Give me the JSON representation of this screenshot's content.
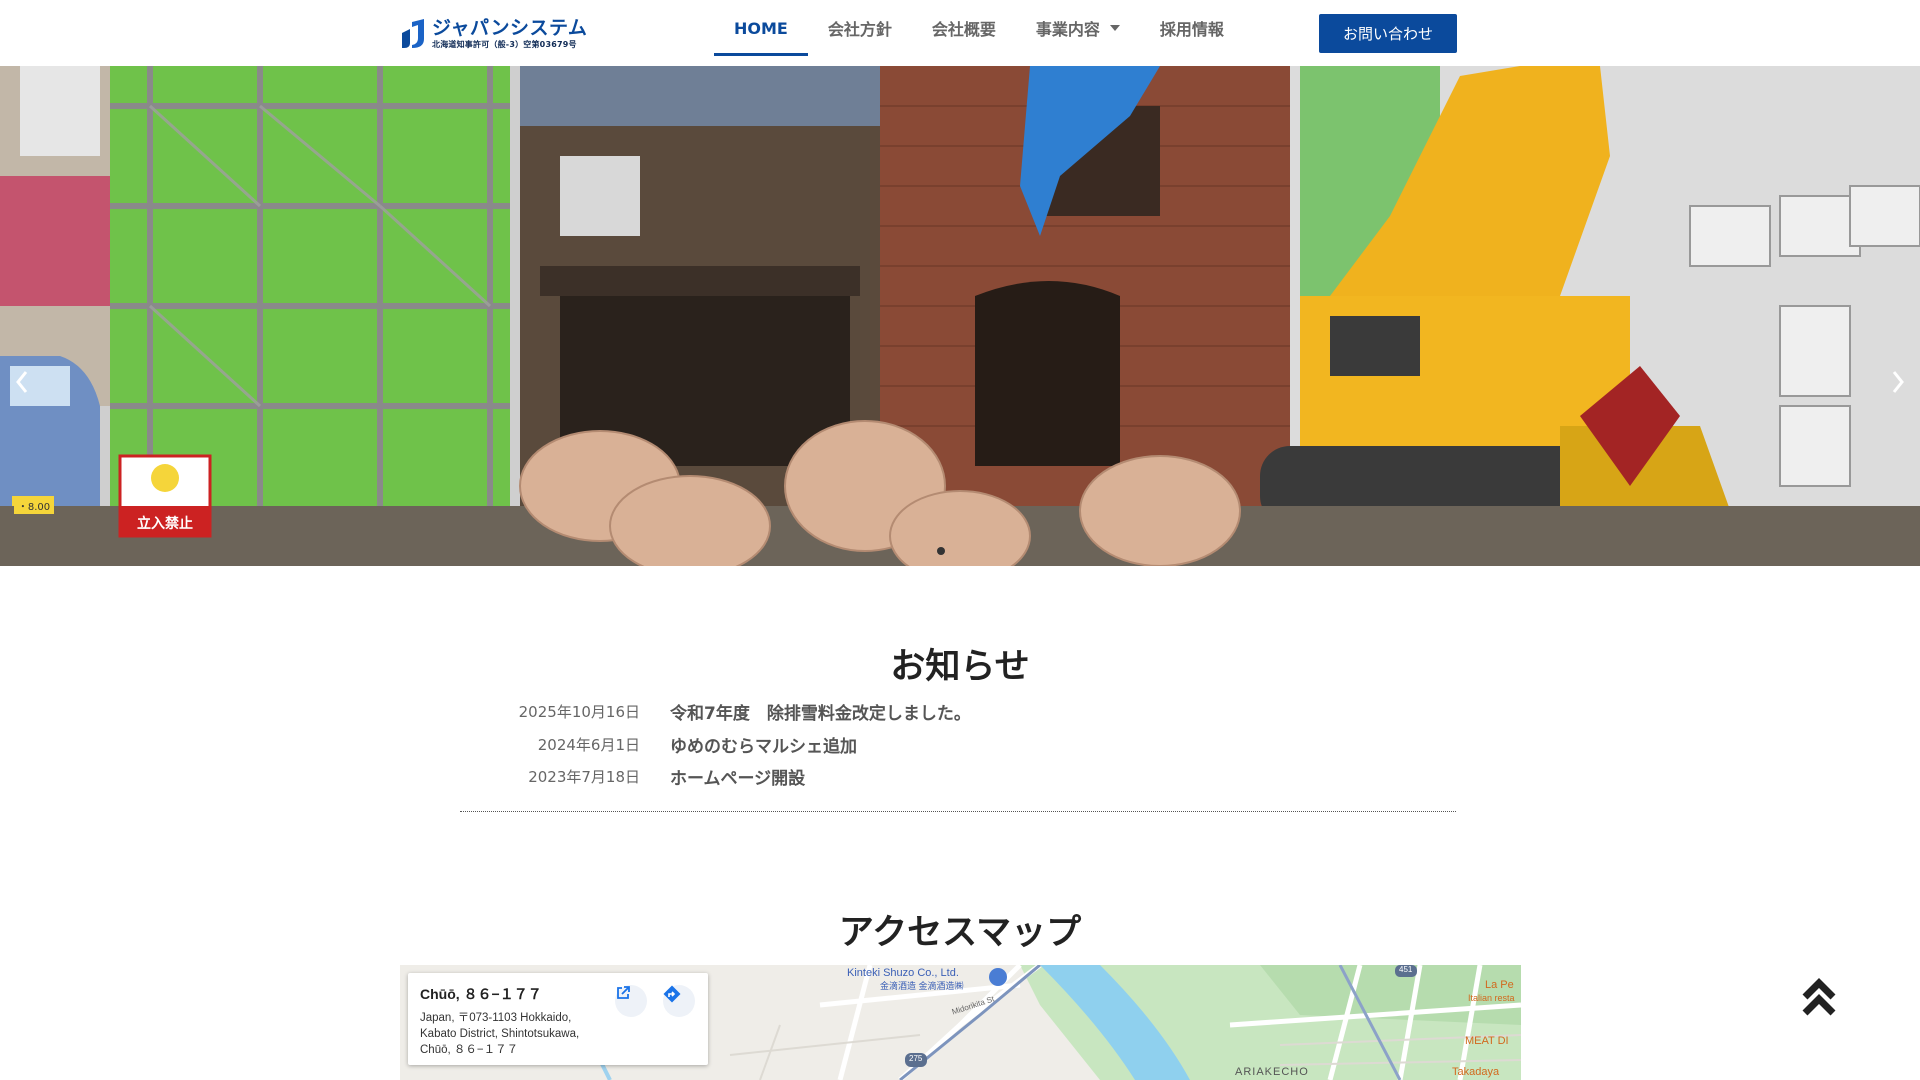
{
  "header": {
    "logo_name": "ジャパンシステム",
    "logo_license": "北海道知事許可（般-3）空第03679号",
    "nav": [
      {
        "label": "HOME",
        "active": true
      },
      {
        "label": "会社方針",
        "active": false
      },
      {
        "label": "会社概要",
        "active": false
      },
      {
        "label": "事業内容",
        "active": false
      },
      {
        "label": "採用情報",
        "active": false
      }
    ],
    "contact_label": "お問い合わせ"
  },
  "hero": {
    "sign_text": "立入禁止",
    "plate_text": "・8.00",
    "slides_total": 1,
    "active_slide": 1
  },
  "news": {
    "title": "お知らせ",
    "items": [
      {
        "date": "2025年10月16日",
        "text": "令和7年度　除排雪料金改定しました。"
      },
      {
        "date": "2024年6月1日",
        "text": "ゆめのむらマルシェ追加"
      },
      {
        "date": "2023年7月18日",
        "text": "ホームページ開設"
      }
    ]
  },
  "access": {
    "title": "アクセスマップ",
    "card": {
      "place": "Chūō, ８６−１７７",
      "address": "Japan, 〒073-1103 Hokkaido, Kabato District, Shintotsukawa, Chūō, ８６−１７７"
    },
    "labels": {
      "shuzo": "Kinteki Shuzo Co., Ltd.",
      "shuzo_jp": "金滴酒造 金滴酒造㈱",
      "street": "Midorikita St",
      "route_275": "275",
      "route_451": "451",
      "district": "ARIAKECHO",
      "restaurant": "La Pe",
      "restaurant_sub": "Italian resta",
      "meat": "MEAT DI",
      "takadaya": "Takadaya"
    }
  },
  "colors": {
    "brand": "#0b4a9c",
    "text_muted": "#666666"
  },
  "icons": {
    "logo": "stylized-j-icon",
    "dropdown": "caret-down-icon",
    "prev": "chevron-left-icon",
    "next": "chevron-right-icon",
    "open_map": "external-link-icon",
    "directions": "directions-icon",
    "back_to_top": "double-chevron-up-icon"
  }
}
